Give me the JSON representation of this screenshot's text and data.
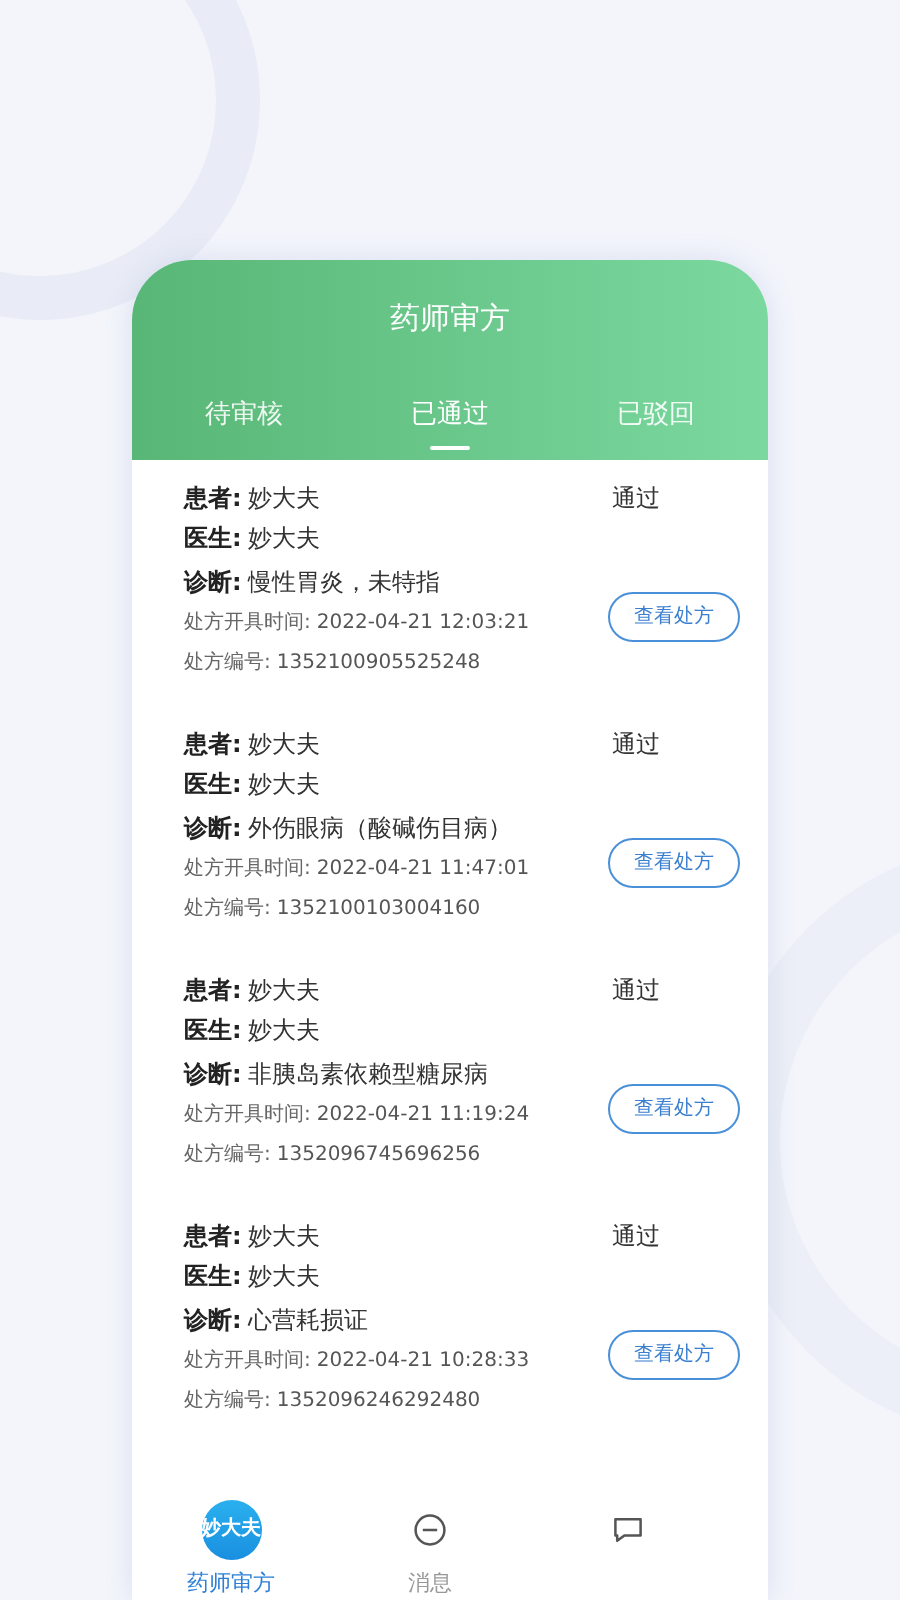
{
  "header": {
    "title": "药师审方"
  },
  "tabs": [
    {
      "label": "待审核",
      "selected": false
    },
    {
      "label": "已通过",
      "selected": true
    },
    {
      "label": "已驳回",
      "selected": false
    }
  ],
  "records": [
    {
      "patient_label": "患者:",
      "patient": "妙大夫",
      "doctor_label": "医生:",
      "doctor": "妙大夫",
      "diagnosis_label": "诊断:",
      "diagnosis": "慢性胃炎，未特指",
      "time_label": "处方开具时间:",
      "time": "2022-04-21 12:03:21",
      "number_label": "处方编号:",
      "number": "1352100905525248",
      "status": "通过",
      "button": "查看处方"
    },
    {
      "patient_label": "患者:",
      "patient": "妙大夫",
      "doctor_label": "医生:",
      "doctor": "妙大夫",
      "diagnosis_label": "诊断:",
      "diagnosis": "外伤眼病（酸碱伤目病）",
      "time_label": "处方开具时间:",
      "time": "2022-04-21 11:47:01",
      "number_label": "处方编号:",
      "number": "1352100103004160",
      "status": "通过",
      "button": "查看处方"
    },
    {
      "patient_label": "患者:",
      "patient": "妙大夫",
      "doctor_label": "医生:",
      "doctor": "妙大夫",
      "diagnosis_label": "诊断:",
      "diagnosis": "非胰岛素依赖型糖尿病",
      "time_label": "处方开具时间:",
      "time": "2022-04-21 11:19:24",
      "number_label": "处方编号:",
      "number": "1352096745696256",
      "status": "通过",
      "button": "查看处方"
    },
    {
      "patient_label": "患者:",
      "patient": "妙大夫",
      "doctor_label": "医生:",
      "doctor": "妙大夫",
      "diagnosis_label": "诊断:",
      "diagnosis": "心营耗损证",
      "time_label": "处方开具时间:",
      "time": "2022-04-21 10:28:33",
      "number_label": "处方编号:",
      "number": "1352096246292480",
      "status": "通过",
      "button": "查看处方"
    }
  ],
  "bottom_nav": [
    {
      "kind": "logo",
      "logo_text": "妙大夫",
      "label": "药师审方",
      "selected": true
    },
    {
      "kind": "message",
      "label": "消息",
      "selected": false
    },
    {
      "kind": "chat",
      "selected": false
    }
  ]
}
